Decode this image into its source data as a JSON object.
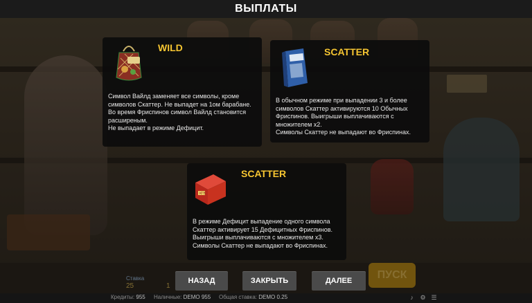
{
  "header": {
    "title": "ВЫПЛАТЫ"
  },
  "panels": {
    "wild": {
      "title": "WILD",
      "text": "Символ Вайлд заменяет все символы, кроме символов Скаттер. Не выпадет на 1ом барабане.\nВо время Фриспинов символ Вайлд становится расширеным.\nНе выпадает в режиме Дефицит.",
      "icon": "shopping-bag-icon"
    },
    "scatter_normal": {
      "title": "SCATTER",
      "text": "В обычном режиме при выпадении 3 и более символов Скаттер активируются 10 Обычных Фриспинов. Выигрыши выплачиваются с множителем x2.\nСимволы Скаттер не выпадают во Фриспинах.",
      "icon": "blue-book-icon"
    },
    "scatter_deficit": {
      "title": "SCATTER",
      "text": "В режиме Дефицит выпадение одного символа Скаттер активирует 15 Дефицитных Фриспинов.\nВыигрыши выплачиваются с множителем x3.\nСимволы Скаттер не выпадают во Фриспинах.",
      "icon": "red-box-icon"
    }
  },
  "buttons": {
    "back": "НАЗАД",
    "close": "ЗАКРЫТЬ",
    "next": "ДАЛЕЕ",
    "spin": "ПУСК"
  },
  "background_labels": {
    "stake_label": "Ставка",
    "stake_value": "25",
    "lines_value": "1"
  },
  "bottom_bar": {
    "credits_label": "Кредиты:",
    "credits_value": "955",
    "cash_label": "Наличные:",
    "cash_value": "DEMO 955",
    "total_stake_label": "Общая ставка:",
    "total_stake_value": "DEMO 0.25"
  },
  "colors": {
    "accent": "#f6c531",
    "panel_bg": "#0c0c0c",
    "button_bg": "#4a4a4a",
    "topbar": "#1b1b1b"
  }
}
